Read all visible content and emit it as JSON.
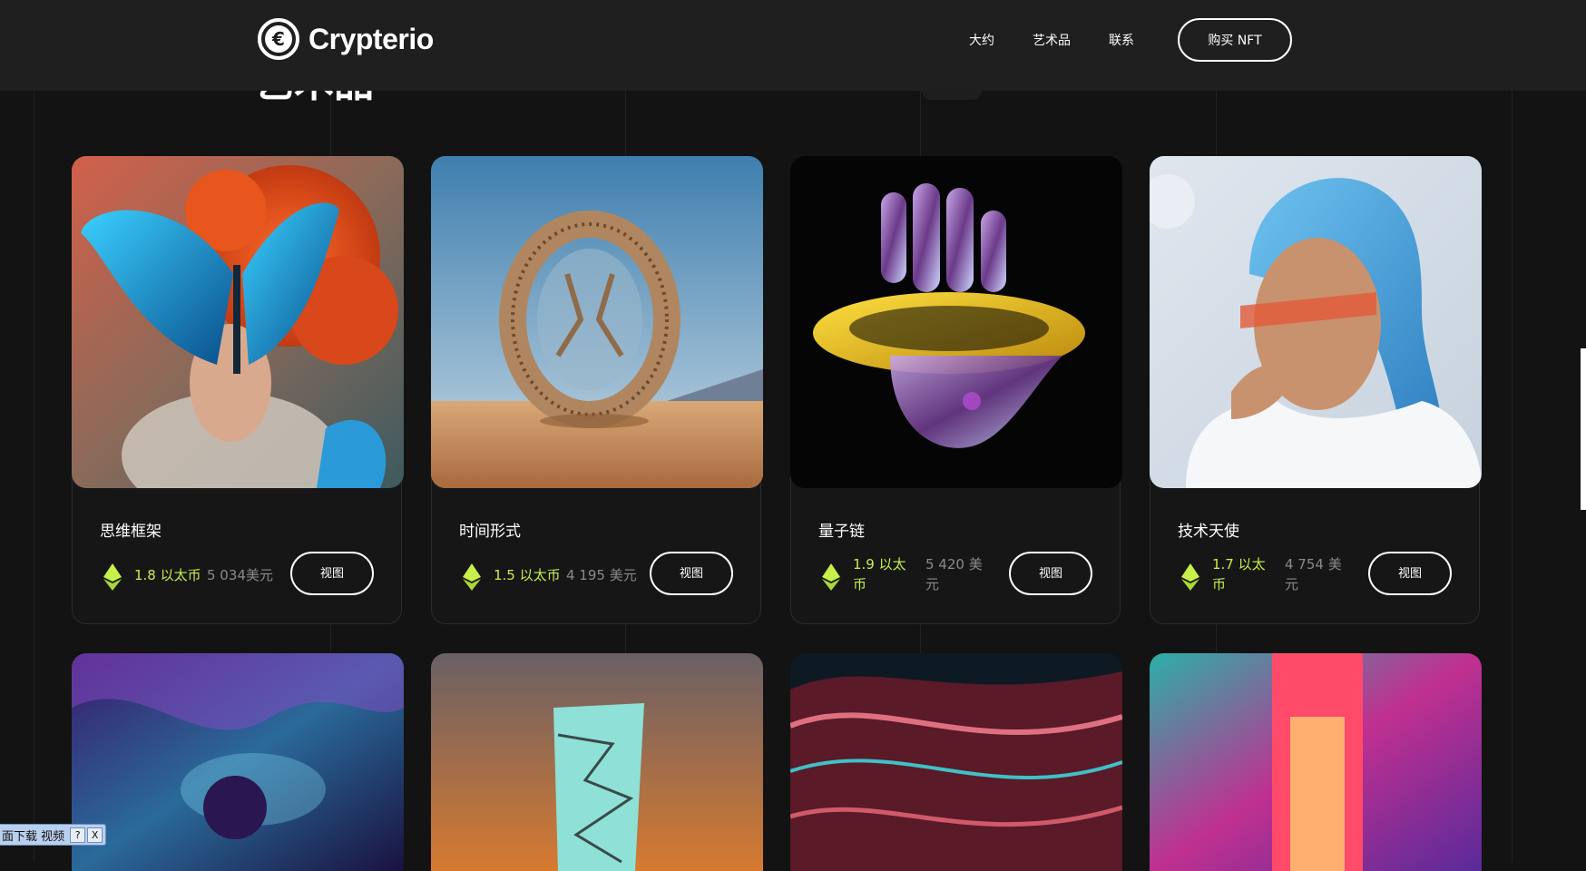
{
  "header": {
    "brand": "Crypterio",
    "nav": [
      "大约",
      "艺术品",
      "联系"
    ],
    "buy_button": "购买 NFT"
  },
  "section_title": "艺术品",
  "colors": {
    "accent": "#c8f04a",
    "background": "#131313",
    "header": "#1f1f1f"
  },
  "cards": [
    {
      "title": "思维框架",
      "eth": "1.8 以太币",
      "usd": "5 034美元",
      "view": "视图",
      "image": "butterfly-woman-art"
    },
    {
      "title": "时间形式",
      "eth": "1.5 以太币",
      "usd": "4 195 美元",
      "view": "视图",
      "image": "desert-ring-city-art"
    },
    {
      "title": "量子链",
      "eth": "1.9 以太币",
      "usd": "5 420 美元",
      "view": "视图",
      "image": "glass-hand-gold-ring-art"
    },
    {
      "title": "技术天使",
      "eth": "1.7 以太币",
      "usd": "4 754 美元",
      "view": "视图",
      "image": "blue-hair-woman-art"
    }
  ],
  "second_row_images": [
    "purple-liquid-art",
    "shattered-monolith-art",
    "red-teal-wave-art",
    "neon-corridor-art"
  ],
  "download_bar": {
    "label": "面下载 视频",
    "help": "?",
    "close": "X"
  }
}
